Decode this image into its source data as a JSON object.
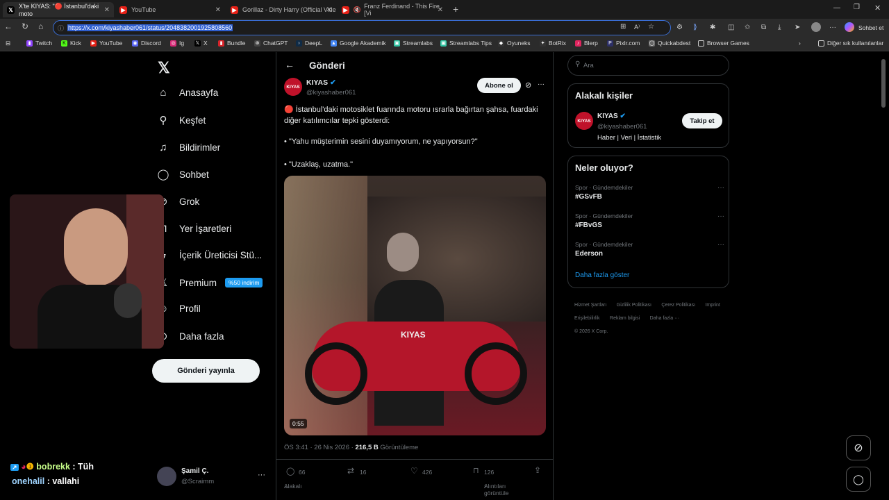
{
  "browser": {
    "tabs": [
      {
        "title": "X'te KIYAS: \"🔴 İstanbul'daki moto",
        "active": true
      },
      {
        "title": "YouTube",
        "active": false
      },
      {
        "title": "Gorillaz - Dirty Harry (Official Vide",
        "active": false
      },
      {
        "title": "Franz Ferdinand - This Fire [Vi",
        "active": false
      }
    ],
    "url": "https://x.com/kiyashaber061/status/2048382001925808560",
    "profile_label": "Sohbet et",
    "bookmarks": [
      "Twitch",
      "Kick",
      "YouTube",
      "Discord",
      "Ig",
      "X",
      "Bundle",
      "ChatGPT",
      "DeepL",
      "Google Akademik",
      "Streamlabs",
      "Streamlabs Tips",
      "Oyuneks",
      "BotRix",
      "Blerp",
      "Pixlr.com",
      "Quickabdest",
      "Browser Games"
    ],
    "other_bookmarks": "Diğer sık kullanılanlar"
  },
  "nav": {
    "items": [
      "Anasayfa",
      "Keşfet",
      "Bildirimler",
      "Sohbet",
      "Grok",
      "Yer İşaretleri",
      "İçerik Üreticisi Stü...",
      "Premium",
      "Profil",
      "Daha fazla"
    ],
    "premium_badge": "%50 indirim",
    "post_button": "Gönderi yayınla",
    "account_name": "Şamil Ç.",
    "account_handle": "@Scraimm"
  },
  "post": {
    "header": "Gönderi",
    "author_name": "KIYAS",
    "author_handle": "@kiyashaber061",
    "avatar_text": "KIYAS",
    "subscribe_button": "Abone ol",
    "text_line1": "🔴 İstanbul'daki motosiklet fuarında motoru ısrarla bağırtan şahsa, fuardaki diğer katılımcılar tepki gösterdi:",
    "quote1": "• \"Yahu müşterimin sesini duyamıyorum, ne yapıyorsun?\"",
    "quote2": "• \"Uzaklaş, uzatma.\"",
    "video_watermark": "KIYAS",
    "video_duration": "0:55",
    "meta_time": "ÖS 3:41 · 26 Nis 2026 · ",
    "views_count": "216,5 B",
    "views_label": "Görüntüleme",
    "replies": "66",
    "reposts": "16",
    "likes": "426",
    "bookmarks": "126",
    "related_label": "Alakalı",
    "quotes_label": "Alıntıları görüntüle"
  },
  "sidebar": {
    "search_placeholder": "Ara",
    "related_title": "Alakalı kişiler",
    "related_name": "KIYAS",
    "related_handle": "@kiyashaber061",
    "related_bio": "Haber | Veri | İstatistik",
    "follow_button": "Takip et",
    "trends_title": "Neler oluyor?",
    "trends": [
      {
        "category": "Spor · Gündemdekiler",
        "tag": "#GSvFB"
      },
      {
        "category": "Spor · Gündemdekiler",
        "tag": "#FBvGS"
      },
      {
        "category": "Spor · Gündemdekiler",
        "tag": "Ederson"
      }
    ],
    "show_more": "Daha fazla göster",
    "footer_links": [
      "Hizmet Şartları",
      "Gizlilik Politikası",
      "Çerez Politikası",
      "Imprint",
      "Erişilebilirlik",
      "Reklam bilgisi",
      "Daha fazla ···"
    ],
    "copyright": "© 2026 X Corp."
  },
  "chat": {
    "line1_user": "bobrekk",
    "line1_msg": " : Tüh",
    "line2_user": "onehalil",
    "line2_msg": " : vallahi"
  },
  "colors": {
    "accent": "#1d9bf0",
    "brand_red": "#e0245e",
    "background": "#000000"
  }
}
